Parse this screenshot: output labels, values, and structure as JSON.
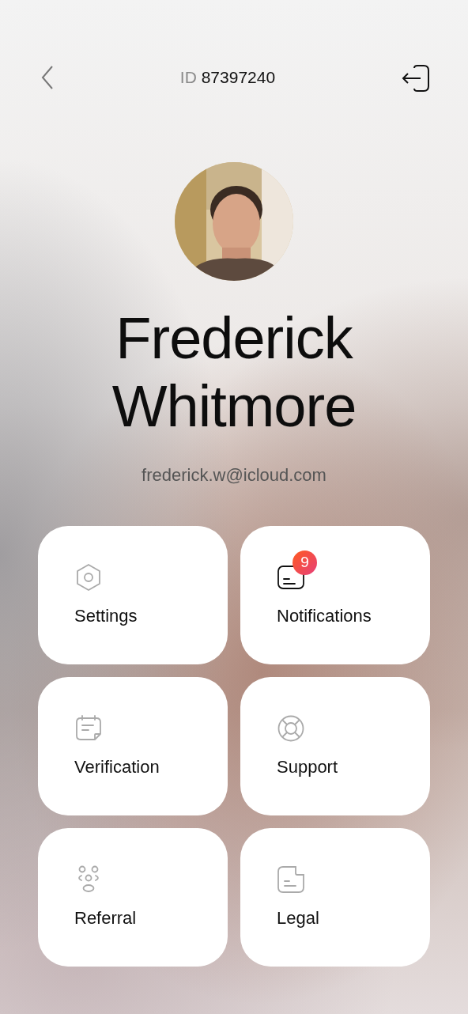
{
  "header": {
    "id_label": "ID",
    "id_value": "87397240"
  },
  "profile": {
    "name": "Frederick Whitmore",
    "email": "frederick.w@icloud.com"
  },
  "tiles": [
    {
      "kind": "settings",
      "label": "Settings",
      "highlighted": false
    },
    {
      "kind": "notifications",
      "label": "Notifications",
      "highlighted": true
    },
    {
      "kind": "verification",
      "label": "Verification",
      "highlighted": false
    },
    {
      "kind": "support",
      "label": "Support",
      "highlighted": false
    },
    {
      "kind": "referral",
      "label": "Referral",
      "highlighted": false
    },
    {
      "kind": "legal",
      "label": "Legal",
      "highlighted": false
    }
  ],
  "notifications_badge": "9"
}
